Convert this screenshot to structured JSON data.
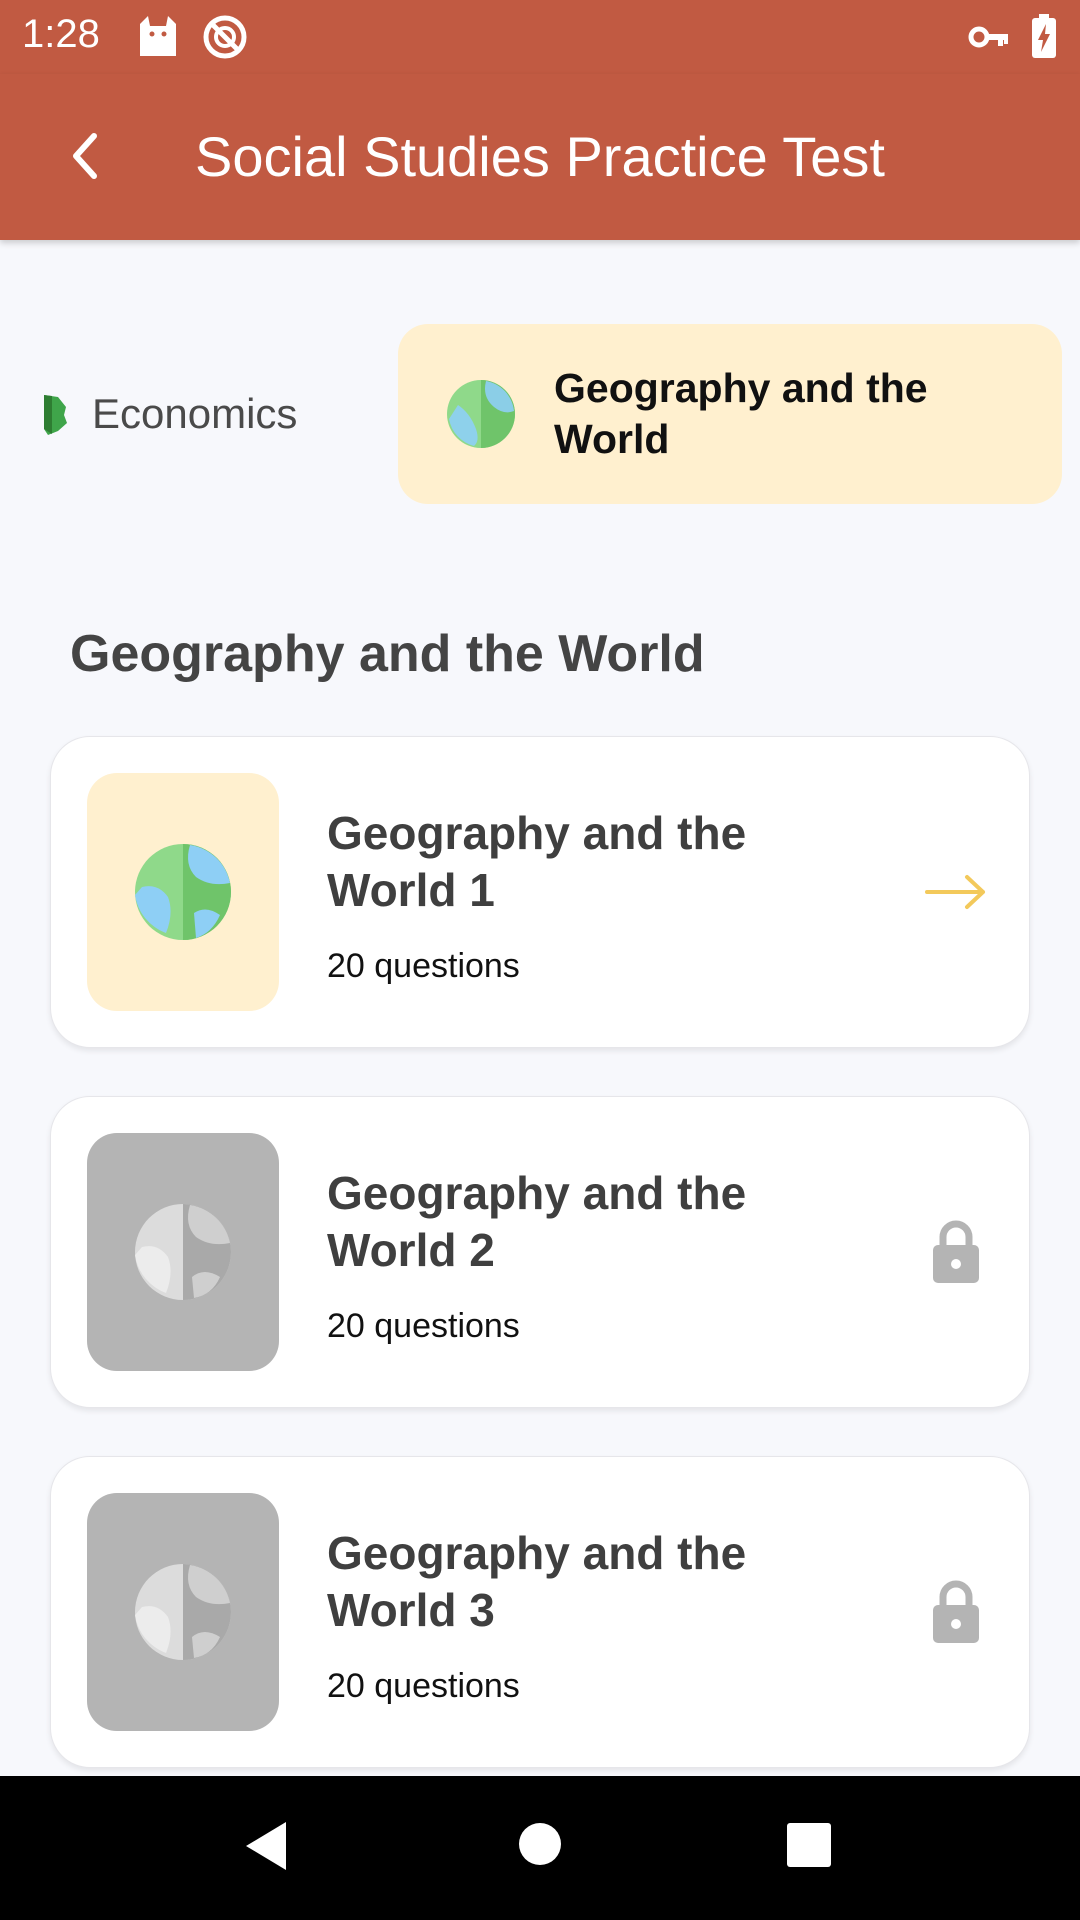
{
  "status_bar": {
    "time": "1:28",
    "icons": [
      "cat-icon",
      "no-sync-icon",
      "vpn-key-icon",
      "battery-charging-icon"
    ]
  },
  "app_bar": {
    "title": "Social Studies Practice Test",
    "back_icon": "chevron-left-icon"
  },
  "tabs": [
    {
      "label": "Economics",
      "icon": "economics-icon",
      "selected": false
    },
    {
      "label": "Geography and the World",
      "icon": "globe-icon",
      "selected": true
    }
  ],
  "section": {
    "title": "Geography and the World"
  },
  "tests": [
    {
      "title": "Geography and the World 1",
      "subtitle": "20 questions",
      "locked": false,
      "action_icon": "arrow-right-icon"
    },
    {
      "title": "Geography and the World 2",
      "subtitle": "20 questions",
      "locked": true,
      "action_icon": "lock-icon"
    },
    {
      "title": "Geography and the World 3",
      "subtitle": "20 questions",
      "locked": true,
      "action_icon": "lock-icon"
    }
  ],
  "colors": {
    "primary": "#c15a42",
    "selected_tab": "#fff0cf",
    "arrow": "#f3c95b",
    "locked": "#b4b4b4"
  },
  "nav_bar": {
    "icons": [
      "back-triangle-icon",
      "home-circle-icon",
      "recents-square-icon"
    ]
  }
}
